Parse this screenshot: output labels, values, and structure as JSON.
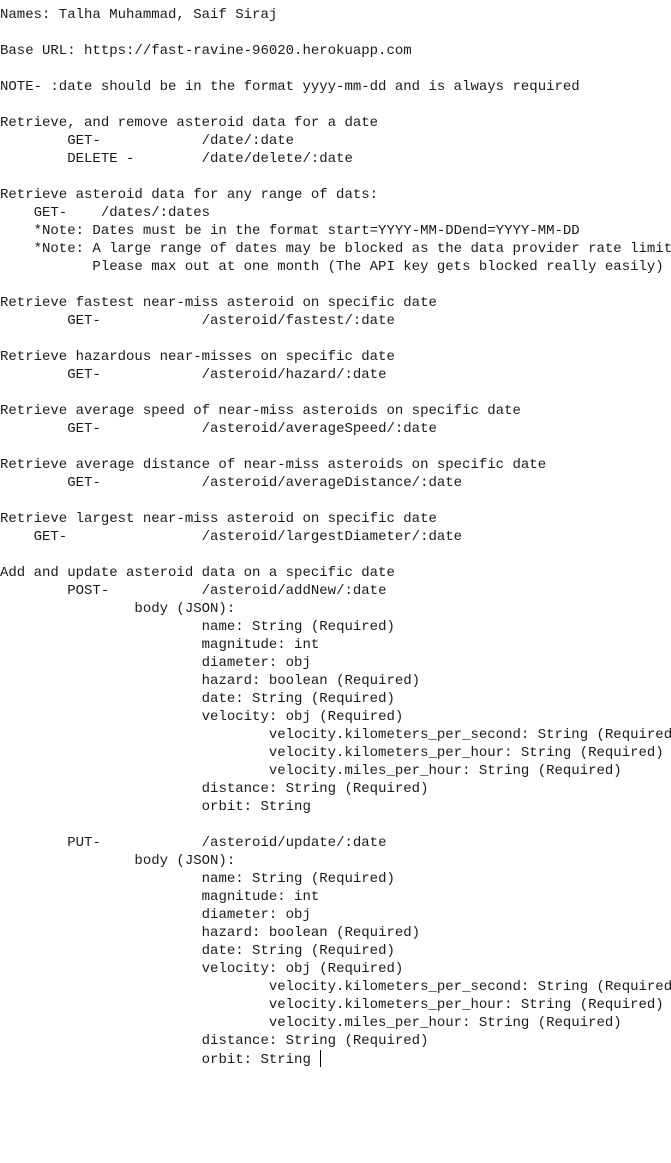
{
  "document": {
    "lines": [
      "Names: Talha Muhammad, Saif Siraj",
      "",
      "Base URL: https://fast-ravine-96020.herokuapp.com",
      "",
      "NOTE- :date should be in the format yyyy-mm-dd and is always required",
      "",
      "Retrieve, and remove asteroid data for a date",
      "\tGET-\t\t/date/:date",
      "\tDELETE -\t/date/delete/:date",
      "",
      "Retrieve asteroid data for any range of dats:",
      "    GET-    /dates/:dates",
      "    *Note: Dates must be in the format start=YYYY-MM-DDend=YYYY-MM-DD",
      "    *Note: A large range of dates may be blocked as the data provider rate limits",
      "           Please max out at one month (The API key gets blocked really easily)",
      "",
      "Retrieve fastest near-miss asteroid on specific date",
      "\tGET-\t\t/asteroid/fastest/:date",
      "",
      "Retrieve hazardous near-misses on specific date",
      "\tGET-\t\t/asteroid/hazard/:date",
      "",
      "Retrieve average speed of near-miss asteroids on specific date",
      "\tGET-\t\t/asteroid/averageSpeed/:date",
      "",
      "Retrieve average distance of near-miss asteroids on specific date",
      "\tGET-\t\t/asteroid/averageDistance/:date",
      "",
      "Retrieve largest near-miss asteroid on specific date",
      "    GET-\t\t/asteroid/largestDiameter/:date",
      "",
      "Add and update asteroid data on a specific date",
      "\tPOST-\t\t/asteroid/addNew/:date",
      "\t\tbody (JSON):",
      "\t\t\tname: String (Required)",
      "\t\t\tmagnitude: int",
      "\t\t\tdiameter: obj",
      "\t\t\thazard: boolean (Required)",
      "\t\t\tdate: String (Required)",
      "\t\t\tvelocity: obj (Required)",
      "\t\t\t\tvelocity.kilometers_per_second: String (Required)",
      "\t\t\t\tvelocity.kilometers_per_hour: String (Required)",
      "\t\t\t\tvelocity.miles_per_hour: String (Required)",
      "\t\t\tdistance: String (Required)",
      "\t\t\torbit: String",
      "",
      "\tPUT-\t\t/asteroid/update/:date",
      "\t\tbody (JSON):",
      "\t\t\tname: String (Required)",
      "\t\t\tmagnitude: int",
      "\t\t\tdiameter: obj",
      "\t\t\thazard: boolean (Required)",
      "\t\t\tdate: String (Required)",
      "\t\t\tvelocity: obj (Required)",
      "\t\t\t\tvelocity.kilometers_per_second: String (Required)",
      "\t\t\t\tvelocity.kilometers_per_hour: String (Required)",
      "\t\t\t\tvelocity.miles_per_hour: String (Required)",
      "\t\t\tdistance: String (Required)",
      "\t\t\torbit: String"
    ]
  }
}
